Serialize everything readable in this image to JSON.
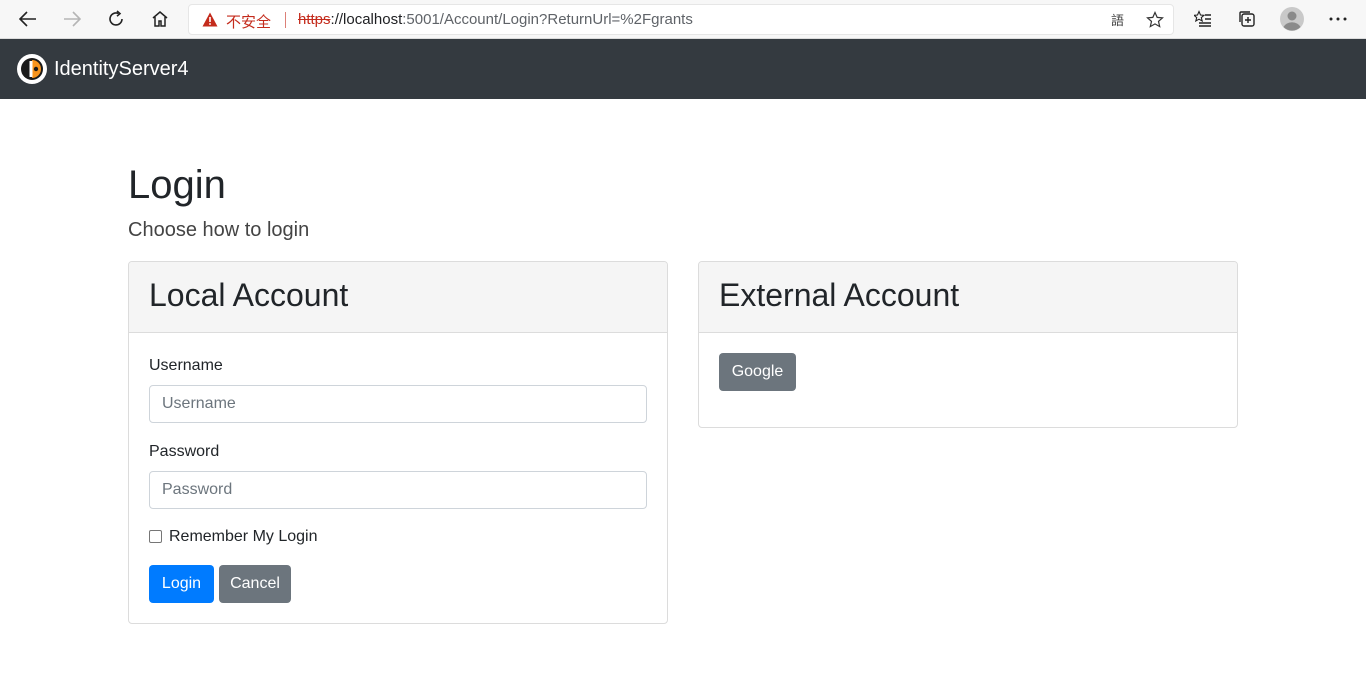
{
  "browser": {
    "insecure_label": "不安全",
    "url_scheme": "https",
    "url_host": "://localhost",
    "url_rest": ":5001/Account/Login?ReturnUrl=%2Fgrants",
    "icons": [
      "back-arrow-icon",
      "forward-arrow-icon",
      "refresh-icon",
      "home-icon",
      "warning-icon",
      "read-aloud-icon",
      "favorite-star-icon",
      "favorites-list-icon",
      "collections-icon",
      "profile-avatar-icon",
      "more-menu-icon"
    ]
  },
  "navbar": {
    "brand": "IdentityServer4",
    "background": "#343a40"
  },
  "page": {
    "title": "Login",
    "subtitle": "Choose how to login"
  },
  "local_account": {
    "title": "Local Account",
    "username_label": "Username",
    "username_placeholder": "Username",
    "password_label": "Password",
    "password_placeholder": "Password",
    "remember_label": "Remember My Login",
    "remember_checked": false,
    "login_button": "Login",
    "cancel_button": "Cancel"
  },
  "external_account": {
    "title": "External Account",
    "providers": [
      "Google"
    ]
  },
  "colors": {
    "primary": "#007bff",
    "secondary": "#6c757d",
    "insecure": "#c42b1c"
  }
}
